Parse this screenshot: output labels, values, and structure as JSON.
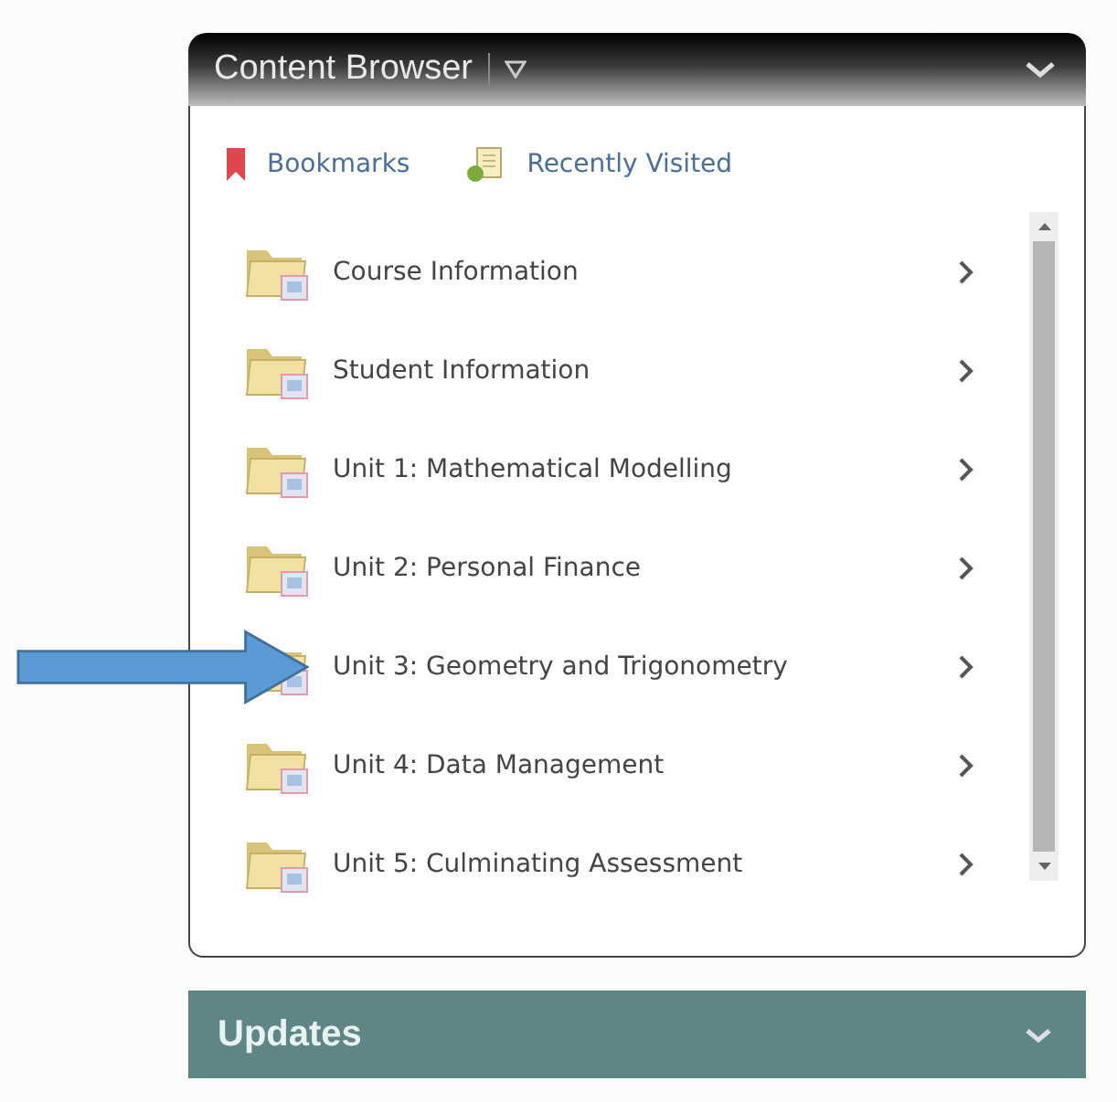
{
  "content_browser": {
    "title": "Content Browser",
    "links": [
      {
        "label": "Bookmarks",
        "kind": "bookmark"
      },
      {
        "label": "Recently Visited",
        "kind": "recent"
      }
    ],
    "items": [
      {
        "label": "Course Information"
      },
      {
        "label": "Student Information"
      },
      {
        "label": "Unit 1: Mathematical Modelling"
      },
      {
        "label": "Unit 2: Personal Finance"
      },
      {
        "label": "Unit 3: Geometry and Trigonometry"
      },
      {
        "label": "Unit 4: Data Management"
      },
      {
        "label": "Unit 5: Culminating Assessment"
      }
    ]
  },
  "updates": {
    "title": "Updates"
  }
}
